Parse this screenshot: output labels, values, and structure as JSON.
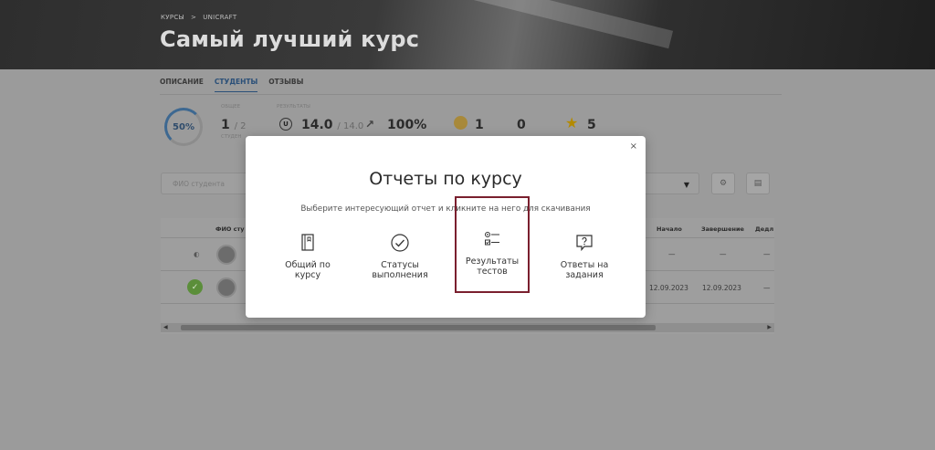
{
  "breadcrumb": {
    "item1": "КУРСЫ",
    "sep": ">",
    "item2": "UNICRAFT"
  },
  "course": {
    "title": "Самый лучший курс"
  },
  "tabs": [
    {
      "label": "ОПИСАНИЕ"
    },
    {
      "label": "СТУДЕНТЫ"
    },
    {
      "label": "ОТЗЫВЫ"
    }
  ],
  "stats": {
    "progress_percent": "50%",
    "label_common": "ОБЩЕЕ",
    "students_value": "1",
    "students_total": "/ 2",
    "students_label": "СТУДЕН",
    "label_results": "РЕЗУЛЬТАТЫ",
    "score_value": "14.0",
    "score_total": "/ 14.0",
    "percent_value": "100%",
    "medal_count": "1",
    "zero_count": "0",
    "star_count": "5"
  },
  "filter": {
    "placeholder": "ФИО студента"
  },
  "table": {
    "headers": {
      "name": "ФИО сту",
      "start": "Начало",
      "end": "Завершение",
      "deadline": "Дедл"
    },
    "rows": [
      {
        "start": "—",
        "end": "—",
        "deadline": "—"
      },
      {
        "start": "12.09.2023",
        "end": "12.09.2023",
        "deadline": "—"
      }
    ]
  },
  "modal": {
    "close": "×",
    "title": "Отчеты по курсу",
    "subtitle": "Выберите интересующий отчет и кликните на него для скачивания",
    "options": [
      {
        "label1": "Общий по",
        "label2": "курсу"
      },
      {
        "label1": "Статусы",
        "label2": "выполнения"
      },
      {
        "label1": "Результаты",
        "label2": "тестов"
      },
      {
        "label1": "Ответы на",
        "label2": "задания"
      }
    ]
  }
}
